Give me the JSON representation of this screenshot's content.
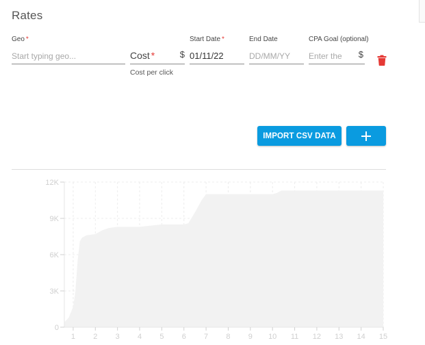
{
  "header": {
    "title": "Rates"
  },
  "form": {
    "geo": {
      "label": "Geo",
      "required_mark": "*",
      "placeholder": "Start typing geo..."
    },
    "cost": {
      "label": "Cost",
      "required_mark": "*",
      "currency": "$",
      "helper": "Cost per click"
    },
    "start_date": {
      "label": "Start Date",
      "required_mark": "*",
      "value": "01/11/22"
    },
    "end_date": {
      "label": "End Date",
      "placeholder": "DD/MM/YY"
    },
    "cpa_goal": {
      "label": "CPA Goal (optional)",
      "placeholder": "Enter the",
      "currency": "$"
    }
  },
  "icons": {
    "delete": "trash-icon",
    "add": "plus-icon"
  },
  "actions": {
    "import_label": "IMPORT CSV DATA"
  },
  "colors": {
    "primary": "#0a9be0",
    "danger": "#e53935",
    "required": "#e53935",
    "chart_fill": "#f2f2f2"
  },
  "chart_data": {
    "type": "area",
    "x": [
      0.6,
      0.8,
      1.0,
      1.1,
      1.2,
      1.3,
      1.4,
      1.6,
      2.0,
      2.3,
      2.6,
      3.0,
      3.5,
      4.0,
      4.5,
      5.0,
      5.5,
      6.0,
      6.2,
      6.5,
      6.8,
      7.0,
      8.0,
      9.0,
      10.0,
      10.2,
      10.4,
      10.6,
      11.0,
      12.0,
      13.0,
      14.0,
      15.0
    ],
    "values": [
      400,
      800,
      1700,
      3000,
      5500,
      7100,
      7400,
      7600,
      7700,
      8000,
      8200,
      8300,
      8300,
      8300,
      8400,
      8500,
      8500,
      8500,
      8600,
      9500,
      10500,
      11000,
      11000,
      11000,
      11000,
      11100,
      11300,
      11300,
      11300,
      11300,
      11300,
      11300,
      11300
    ],
    "xlim": [
      0.6,
      15
    ],
    "ylim": [
      0,
      12000
    ],
    "x_ticks": [
      1,
      2,
      3,
      4,
      5,
      6,
      7,
      8,
      9,
      10,
      11,
      12,
      13,
      14,
      15
    ],
    "y_ticks": [
      0,
      3000,
      6000,
      9000,
      12000
    ],
    "y_tick_labels": [
      "0",
      "3K",
      "6K",
      "9K",
      "12K"
    ],
    "grid": true
  }
}
